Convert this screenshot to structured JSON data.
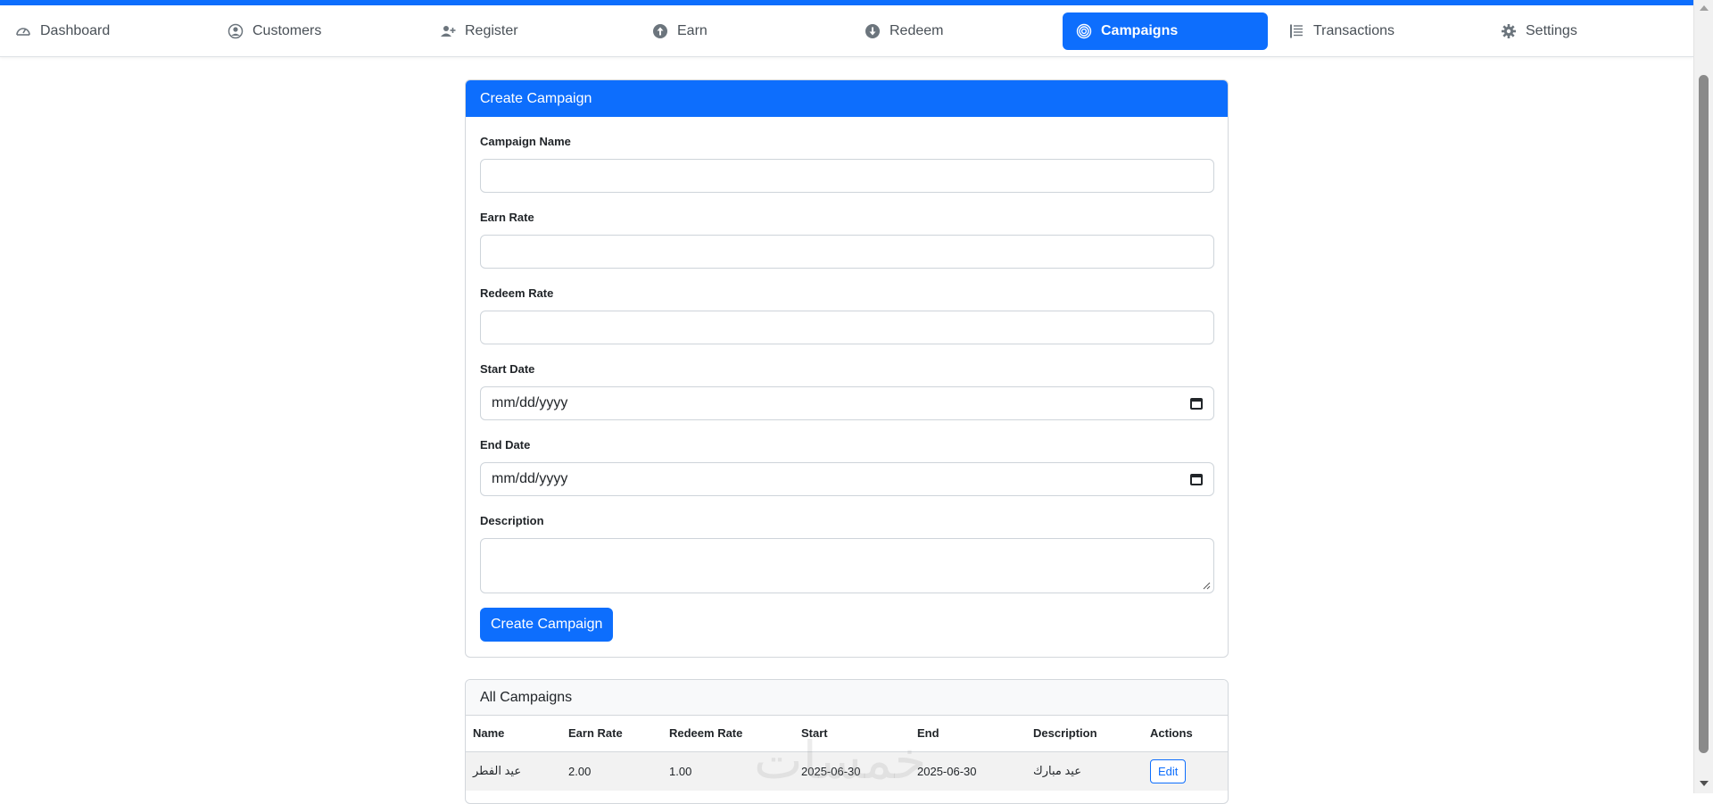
{
  "nav": {
    "items": [
      {
        "label": "Dashboard",
        "icon": "speedometer-icon"
      },
      {
        "label": "Customers",
        "icon": "person-circle-icon"
      },
      {
        "label": "Register",
        "icon": "person-plus-icon"
      },
      {
        "label": "Earn",
        "icon": "arrow-up-circle-icon"
      },
      {
        "label": "Redeem",
        "icon": "arrow-down-circle-icon"
      },
      {
        "label": "Campaigns",
        "icon": "bullseye-icon",
        "active": true
      },
      {
        "label": "Transactions",
        "icon": "list-icon"
      },
      {
        "label": "Settings",
        "icon": "gear-icon"
      }
    ]
  },
  "create_form": {
    "title": "Create Campaign",
    "campaign_name_label": "Campaign Name",
    "campaign_name_value": "",
    "earn_rate_label": "Earn Rate",
    "earn_rate_value": "",
    "redeem_rate_label": "Redeem Rate",
    "redeem_rate_value": "",
    "start_date_label": "Start Date",
    "start_date_placeholder": "mm/dd/yyyy",
    "end_date_label": "End Date",
    "end_date_placeholder": "mm/dd/yyyy",
    "description_label": "Description",
    "description_value": "",
    "submit_label": "Create Campaign"
  },
  "campaigns": {
    "title": "All Campaigns",
    "columns": [
      "Name",
      "Earn Rate",
      "Redeem Rate",
      "Start",
      "End",
      "Description",
      "Actions"
    ],
    "rows": [
      {
        "name": "عيد الفطر",
        "earn_rate": "2.00",
        "redeem_rate": "1.00",
        "start": "2025-06-30",
        "end": "2025-06-30",
        "description": "عيد مبارك",
        "action": "Edit"
      }
    ]
  },
  "watermark": "خمسات",
  "colors": {
    "accent": "#0d6efd"
  }
}
